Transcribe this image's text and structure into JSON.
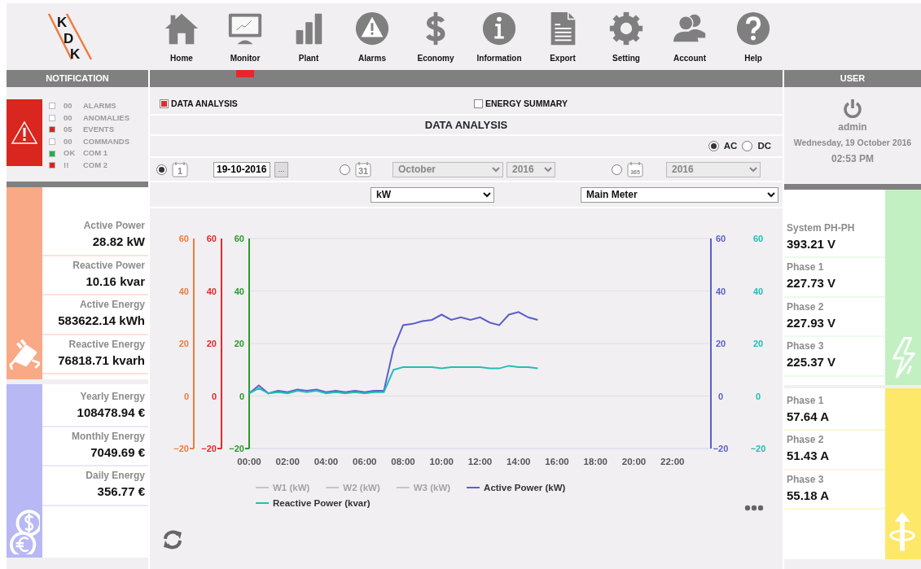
{
  "logo": {
    "letters": [
      "K",
      "D",
      "K"
    ]
  },
  "nav": [
    {
      "label": "Home",
      "kind": "home",
      "selected": false
    },
    {
      "label": "Monitor",
      "kind": "monitor",
      "selected": true
    },
    {
      "label": "Plant",
      "kind": "bars",
      "selected": false
    },
    {
      "label": "Alarms",
      "kind": "warning",
      "selected": false
    },
    {
      "label": "Economy",
      "kind": "dollar",
      "selected": false
    },
    {
      "label": "Information",
      "kind": "info",
      "selected": false
    },
    {
      "label": "Export",
      "kind": "document",
      "selected": false
    },
    {
      "label": "Setting",
      "kind": "gear",
      "selected": false
    },
    {
      "label": "Account",
      "kind": "users",
      "selected": false
    },
    {
      "label": "Help",
      "kind": "help",
      "selected": false
    }
  ],
  "notification": {
    "title": "NOTIFICATION",
    "items": [
      {
        "count": "00",
        "label": "ALARMS",
        "color": "#ffffff"
      },
      {
        "count": "00",
        "label": "ANOMALIES",
        "color": "#ffffff"
      },
      {
        "count": "05",
        "label": "EVENTS",
        "color": "#d9261e"
      },
      {
        "count": "00",
        "label": "COMMANDS",
        "color": "#ffffff"
      },
      {
        "count": "OK",
        "label": "COM 1",
        "color": "#22b14c"
      },
      {
        "count": "!!",
        "label": "COM 2",
        "color": "#d9261e"
      }
    ]
  },
  "left_panels": [
    {
      "color": "#f9a985",
      "kind": "plug",
      "items": [
        {
          "label": "Active Power",
          "value": "28.82 kW"
        },
        {
          "label": "Reactive Power",
          "value": "10.16 kvar"
        },
        {
          "label": "Active Energy",
          "value": "583622.14 kWh"
        },
        {
          "label": "Reactive Energy",
          "value": "76818.71 kvarh"
        }
      ]
    },
    {
      "color": "#b8b8f4",
      "kind": "coins",
      "items": [
        {
          "label": "Yearly Energy",
          "value": "108478.94 €"
        },
        {
          "label": "Monthly Energy",
          "value": "7049.69 €"
        },
        {
          "label": "Daily Energy",
          "value": "356.77 €"
        }
      ]
    }
  ],
  "main": {
    "tabs": [
      {
        "label": "DATA ANALYSIS",
        "checked": true
      },
      {
        "label": "ENERGY SUMMARY",
        "checked": false
      }
    ],
    "title": "DATA ANALYSIS",
    "current_type": [
      {
        "label": "AC",
        "selected": true
      },
      {
        "label": "DC",
        "selected": false
      }
    ],
    "periods": [
      {
        "kind": "day",
        "selected": true,
        "icon_text": "1",
        "date": "19-10-2016",
        "button": "..."
      },
      {
        "kind": "month",
        "selected": false,
        "icon_text": "31",
        "selects": [
          {
            "value": "October",
            "disabled": true
          },
          {
            "value": "2016",
            "disabled": true
          }
        ]
      },
      {
        "kind": "year",
        "selected": false,
        "icon_text": "365",
        "selects": [
          {
            "value": "2016",
            "disabled": true
          }
        ]
      }
    ],
    "unit_select": {
      "value": "kW"
    },
    "meter_select": {
      "value": "Main Meter"
    },
    "extra_axes": [
      {
        "kind": "left",
        "color": "#f07b3f",
        "ticks": [
          "60",
          "40",
          "20",
          "0",
          "−20"
        ]
      },
      {
        "kind": "left",
        "color": "#e8262b",
        "ticks": [
          "60",
          "40",
          "20",
          "0",
          "−20"
        ]
      },
      {
        "kind": "left",
        "color": "#2b9a2b",
        "ticks": [
          "60",
          "40",
          "20",
          "0",
          "−20"
        ]
      },
      {
        "kind": "right",
        "color": "#1fbfb8",
        "ticks": [
          "60",
          "40",
          "20",
          "0",
          "−20"
        ]
      }
    ],
    "legend_extra": [
      {
        "label": "W1 (kW)",
        "enabled": false
      },
      {
        "label": "W2 (kW)",
        "enabled": false
      },
      {
        "label": "W3 (kW)",
        "enabled": false
      }
    ],
    "chart_data": {
      "type": "line",
      "x": [
        0,
        0.5,
        1,
        1.5,
        2,
        2.5,
        3,
        3.5,
        4,
        4.5,
        5,
        5.5,
        6,
        6.5,
        7,
        7.5,
        8,
        8.5,
        9,
        9.5,
        10,
        10.5,
        11,
        11.5,
        12,
        12.5,
        13,
        13.5,
        14,
        14.5,
        15
      ],
      "xlim": [
        0,
        24
      ],
      "ylim": [
        -20,
        60
      ],
      "xticks": [
        {
          "value": 0,
          "label": "00:00"
        },
        {
          "value": 2,
          "label": "02:00"
        },
        {
          "value": 4,
          "label": "04:00"
        },
        {
          "value": 6,
          "label": "06:00"
        },
        {
          "value": 8,
          "label": "08:00"
        },
        {
          "value": 10,
          "label": "10:00"
        },
        {
          "value": 12,
          "label": "12:00"
        },
        {
          "value": 14,
          "label": "14:00"
        },
        {
          "value": 16,
          "label": "16:00"
        },
        {
          "value": 18,
          "label": "18:00"
        },
        {
          "value": 20,
          "label": "20:00"
        },
        {
          "value": 22,
          "label": "22:00"
        }
      ],
      "yticks": [
        -20,
        0,
        20,
        40,
        60
      ],
      "grid": true,
      "legend": "bottom",
      "series": [
        {
          "name": "Active Power (kW)",
          "color": "#5b5fc7",
          "values": [
            1,
            4,
            1,
            2,
            1.5,
            2.5,
            2,
            2.5,
            1.5,
            2,
            1.5,
            2,
            1.5,
            2,
            2,
            18,
            27,
            27.5,
            28.5,
            29,
            31,
            29,
            30,
            29,
            30,
            28,
            27,
            31,
            32,
            30,
            29
          ]
        },
        {
          "name": "Reactive Power (kvar)",
          "color": "#1fbfb8",
          "values": [
            1,
            3,
            1,
            1.5,
            1,
            2,
            1.5,
            2,
            1,
            1.5,
            1,
            1.5,
            1,
            1.5,
            1.5,
            10,
            11,
            11,
            11,
            11,
            10.5,
            11,
            11,
            11,
            11,
            10.5,
            10.5,
            11.5,
            11,
            11,
            10.5
          ]
        }
      ]
    }
  },
  "user": {
    "title": "USER",
    "name": "admin",
    "date": "Wednesday, 19 October 2016",
    "time": "02:53 PM"
  },
  "right_panels": [
    {
      "color": "#c3f0c3",
      "kind": "lightning",
      "items": [
        {
          "label": "System PH-PH",
          "value": "393.21 V"
        },
        {
          "label": "Phase 1",
          "value": "227.73 V"
        },
        {
          "label": "Phase 2",
          "value": "227.93 V"
        },
        {
          "label": "Phase 3",
          "value": "225.37 V"
        }
      ]
    },
    {
      "color": "#fde86a",
      "kind": "arrow",
      "items": [
        {
          "label": "Phase 1",
          "value": "57.64 A"
        },
        {
          "label": "Phase 2",
          "value": "51.43 A"
        },
        {
          "label": "Phase 3",
          "value": "55.18 A"
        }
      ]
    }
  ]
}
